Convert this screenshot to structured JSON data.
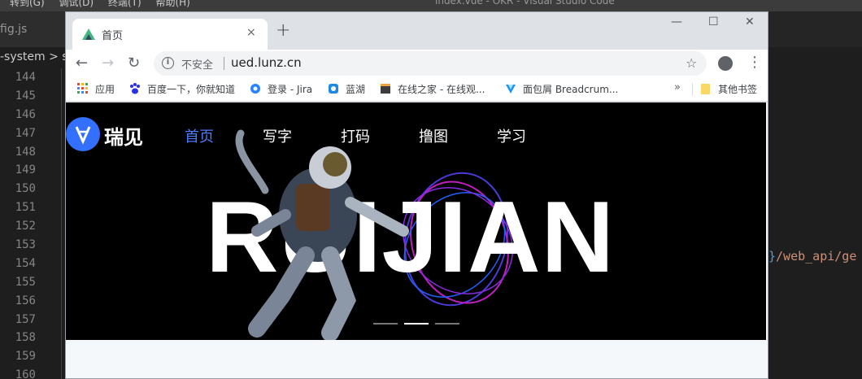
{
  "vscode": {
    "menu": [
      "转到(G)",
      "调试(D)",
      "终端(T)",
      "帮助(H)"
    ],
    "window_title": "index.vue - OKR - Visual Studio Code",
    "tab_label": "fig.js",
    "breadcrumb": "-system > s",
    "line_numbers": [
      "144",
      "145",
      "146",
      "147",
      "148",
      "149",
      "150",
      "151",
      "152",
      "153",
      "154",
      "155",
      "156",
      "157",
      "158",
      "159",
      "160"
    ],
    "code_brace": "}",
    "code_string": "/web_api/ge"
  },
  "chrome": {
    "tab_title": "首页",
    "tab_close": "×",
    "new_tab": "+",
    "window_controls": [
      "—",
      "☐",
      "✕"
    ],
    "back": "←",
    "forward": "→",
    "reload": "↻",
    "security_label": "不安全",
    "url": "ued.lunz.cn",
    "star": "☆",
    "menu": "⋮",
    "bookmarks": [
      {
        "label": "应用",
        "icon": "apps-grid-icon",
        "color": "#ea4335"
      },
      {
        "label": "百度一下，你就知道",
        "icon": "baidu-paw-icon",
        "color": "#2932e1"
      },
      {
        "label": "登录 - Jira",
        "icon": "jira-gear-icon",
        "color": "#2684ff"
      },
      {
        "label": "蓝湖",
        "icon": "lanhu-icon",
        "color": "#1e88e5"
      },
      {
        "label": "在线之家 - 在线观...",
        "icon": "film-clapper-icon",
        "color": "#3c3c3c"
      },
      {
        "label": "面包屑 Breadcrum...",
        "icon": "vuetify-icon",
        "color": "#1697f6"
      }
    ],
    "bookmarks_more": "»",
    "other_bookmarks": "其他书签"
  },
  "site": {
    "brand": "瑞见",
    "nav": [
      "首页",
      "写字",
      "打码",
      "撸图",
      "学习"
    ],
    "active_nav": 0,
    "hero_text": "RUIJIAN",
    "carousel_count": 3,
    "carousel_active": 1,
    "accent_color": "#3370ff"
  }
}
